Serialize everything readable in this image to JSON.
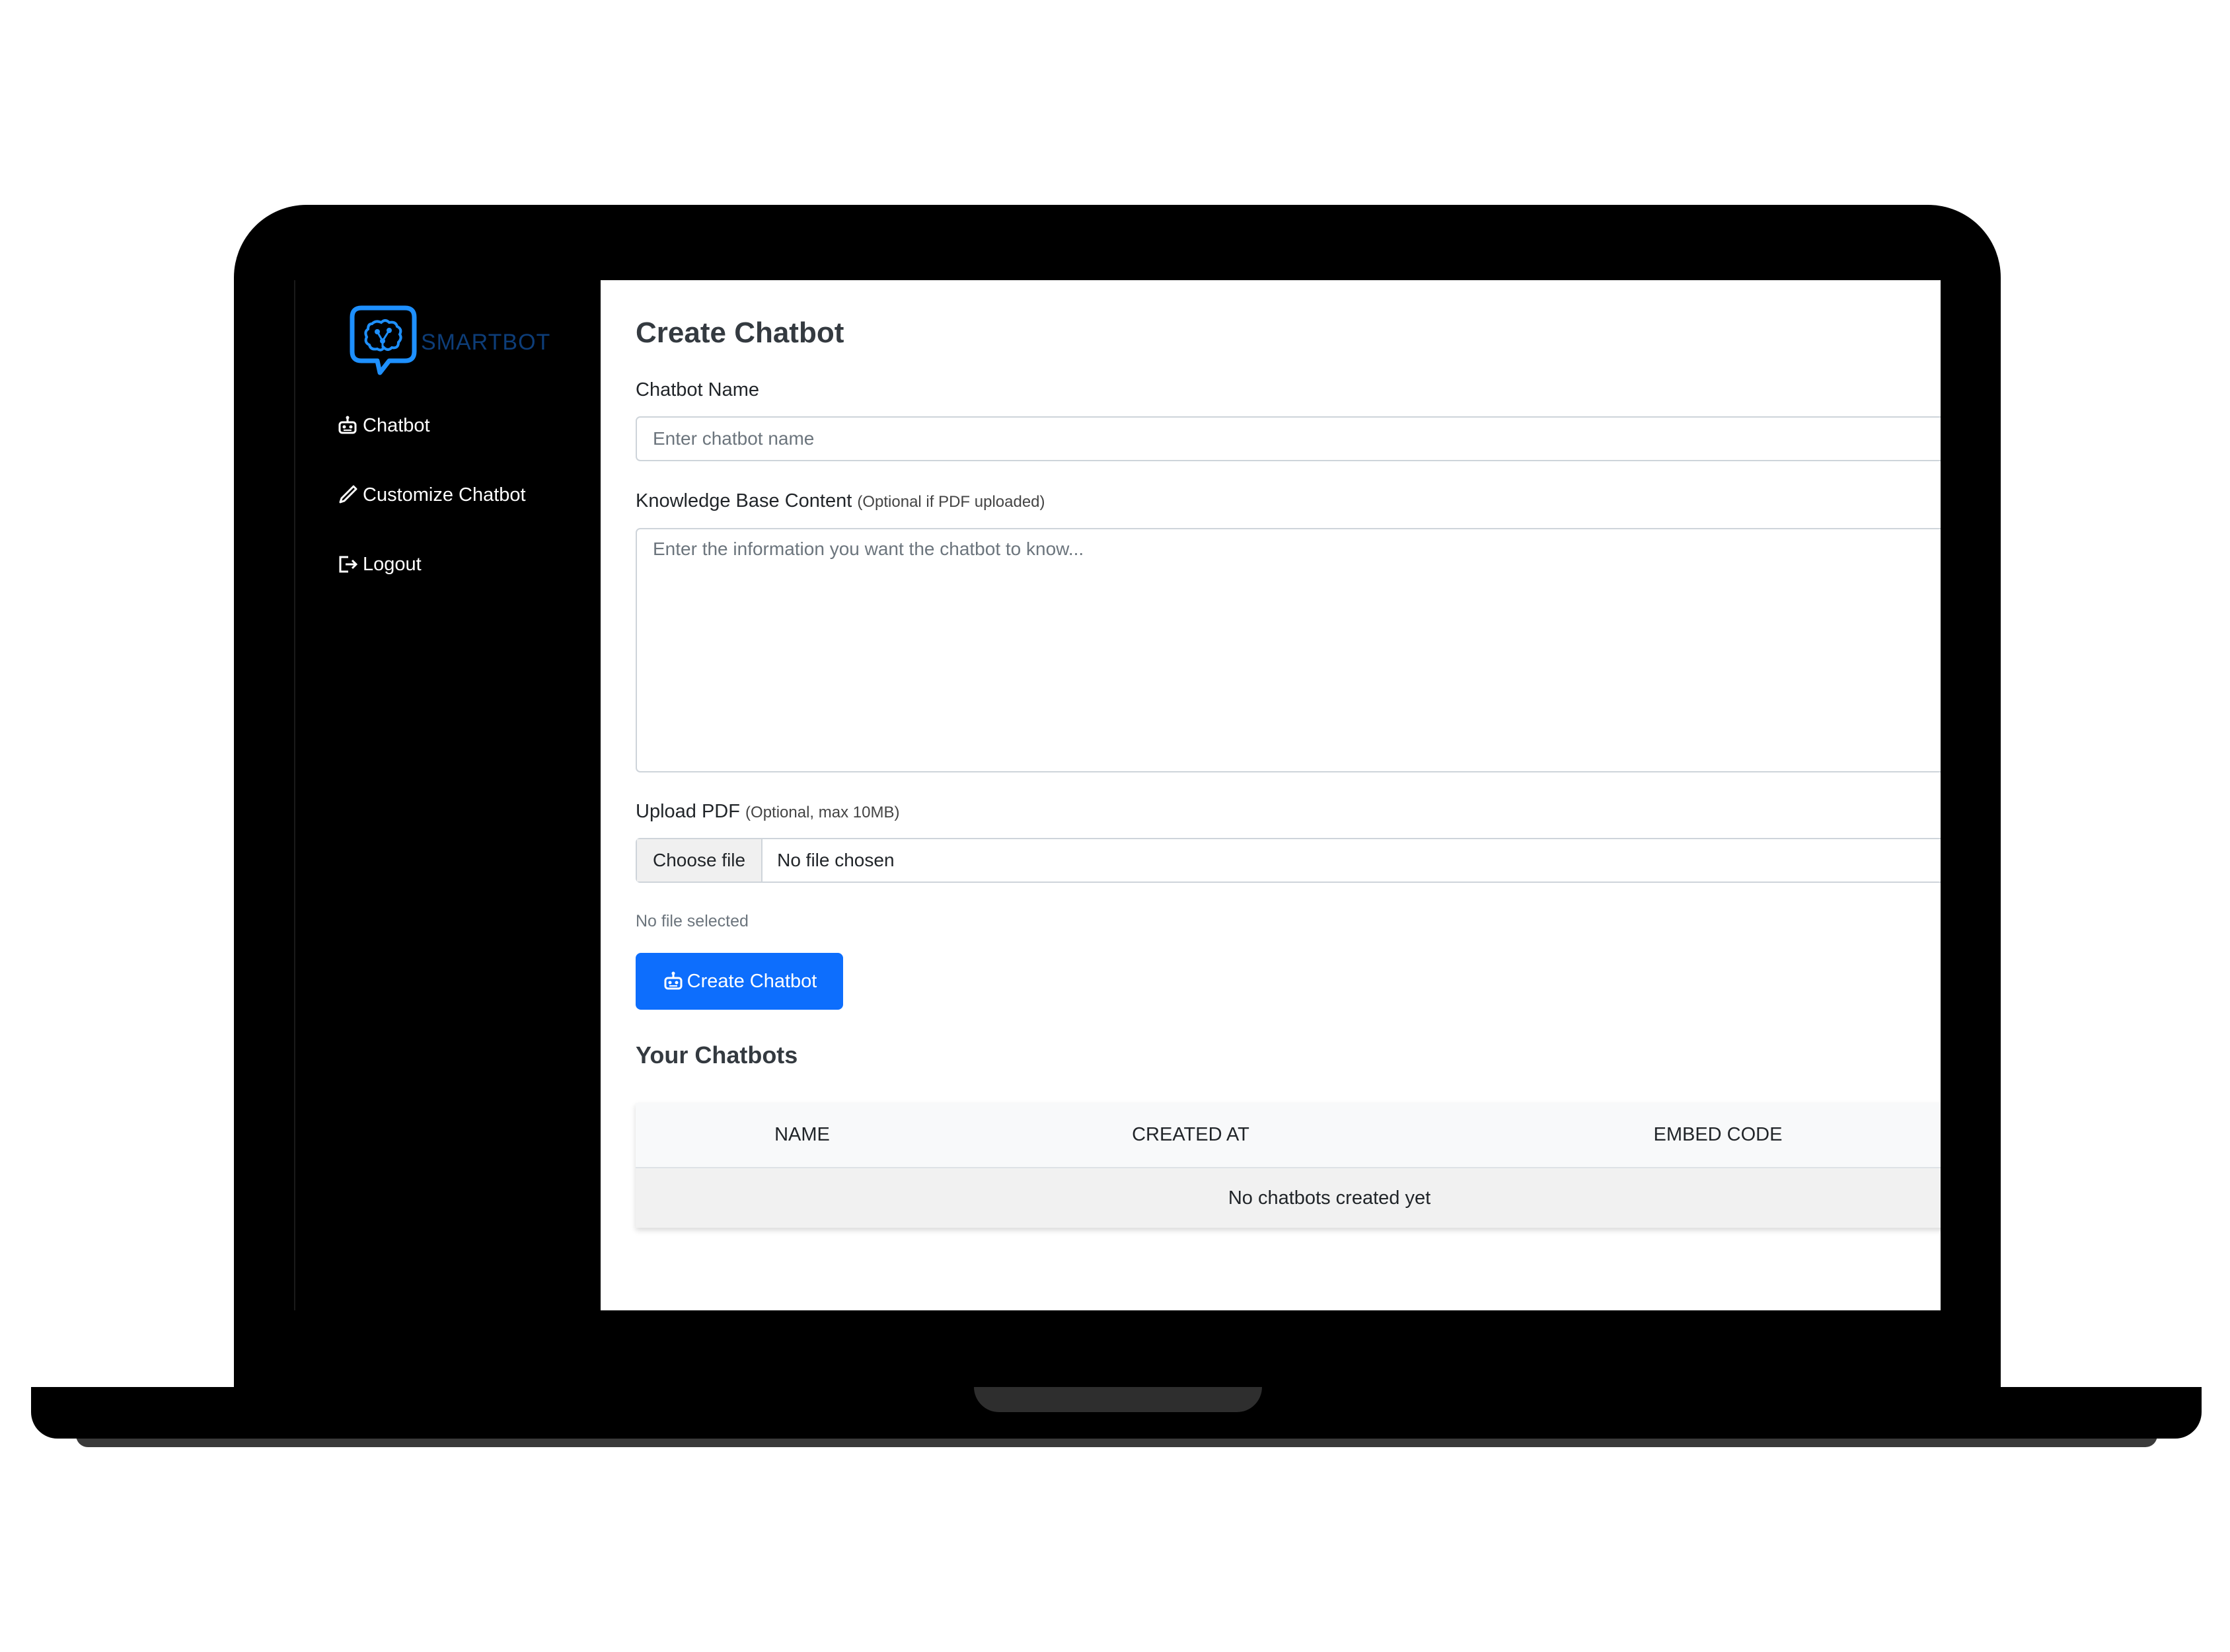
{
  "brand": {
    "name": "SMARTBOT",
    "logo_icon": "brain-chat-logo",
    "color": "#0d3d78",
    "logo_color": "#1e90ff"
  },
  "sidebar": {
    "items": [
      {
        "label": "Chatbot",
        "icon": "robot-icon"
      },
      {
        "label": "Customize Chatbot",
        "icon": "pencil-icon"
      },
      {
        "label": "Logout",
        "icon": "logout-icon"
      }
    ]
  },
  "main": {
    "title": "Create Chatbot",
    "chatbot_name": {
      "label": "Chatbot Name",
      "placeholder": "Enter chatbot name",
      "value": ""
    },
    "knowledge_base": {
      "label": "Knowledge Base Content",
      "hint": "(Optional if PDF uploaded)",
      "placeholder": "Enter the information you want the chatbot to know...",
      "value": ""
    },
    "upload_pdf": {
      "label": "Upload PDF",
      "hint": "(Optional, max 10MB)",
      "button_label": "Choose file",
      "status": "No file chosen",
      "note": "No file selected"
    },
    "create_button": {
      "label": "Create Chatbot",
      "icon": "robot-icon",
      "color": "#0d6efd"
    },
    "chatbots": {
      "title": "Your Chatbots",
      "columns": [
        "NAME",
        "CREATED AT",
        "EMBED CODE"
      ],
      "empty_message": "No chatbots created yet"
    }
  }
}
